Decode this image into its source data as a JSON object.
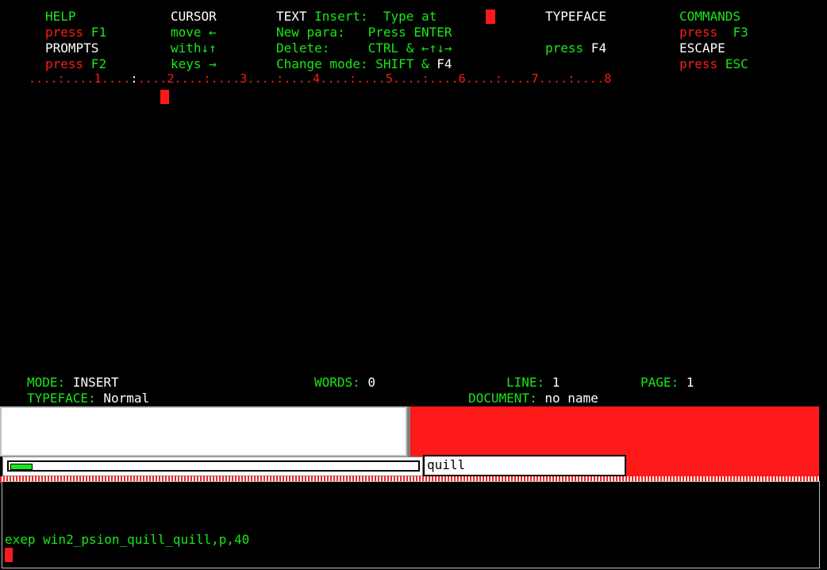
{
  "app": "Psion Quill (win2)",
  "help": {
    "col1": {
      "title": "HELP",
      "line1_a": "press",
      "line1_b": " F1",
      "title2": "PROMPTS",
      "line2_a": "press",
      "line2_b": " F2"
    },
    "col2": {
      "title": "CURSOR",
      "line1": "move ←",
      "line2": "with↓↑",
      "line3": "keys →"
    },
    "col3": {
      "title": "TEXT",
      "title_insert": " Insert:",
      "type_at": "  Type at",
      "newpara_label": "New para:",
      "newpara_val": "   Press ENTER",
      "delete_label": "Delete:",
      "delete_val": "     CTRL & ←↑↓→",
      "change_label": "Change mode: SHIFT &",
      "change_key": " F4"
    },
    "col4": {
      "title": "TYPEFACE",
      "press": "press",
      "key": " F4"
    },
    "col5": {
      "title": "COMMANDS",
      "line1_a": "press",
      "line1_b": "  F3",
      "title2": "ESCAPE",
      "line2_a": "press",
      "line2_b": " ESC"
    }
  },
  "ruler": {
    "part1": "....:....1....",
    "cursor_mark": ":",
    "part2": "....2....:....3....:....4....:....5....:....6....:....7....:....8"
  },
  "status": {
    "mode_label": "MODE:",
    "mode_value": " INSERT",
    "typeface_label": "TYPEFACE:",
    "typeface_value": " Normal",
    "words_label": "WORDS:",
    "words_value": " 0",
    "line_label": "LINE:",
    "line_value": " 1",
    "page_label": "PAGE:",
    "page_value": " 1",
    "document_label": "DOCUMENT:",
    "document_value": " no name"
  },
  "taskbar": {
    "progress": 0.05,
    "active_window": "quill"
  },
  "console": {
    "command": "exep win2_psion_quill_quill,p,40"
  },
  "colors": {
    "background": "#000000",
    "green": "#19e619",
    "red": "#ff1a1a",
    "white": "#ffffff"
  }
}
